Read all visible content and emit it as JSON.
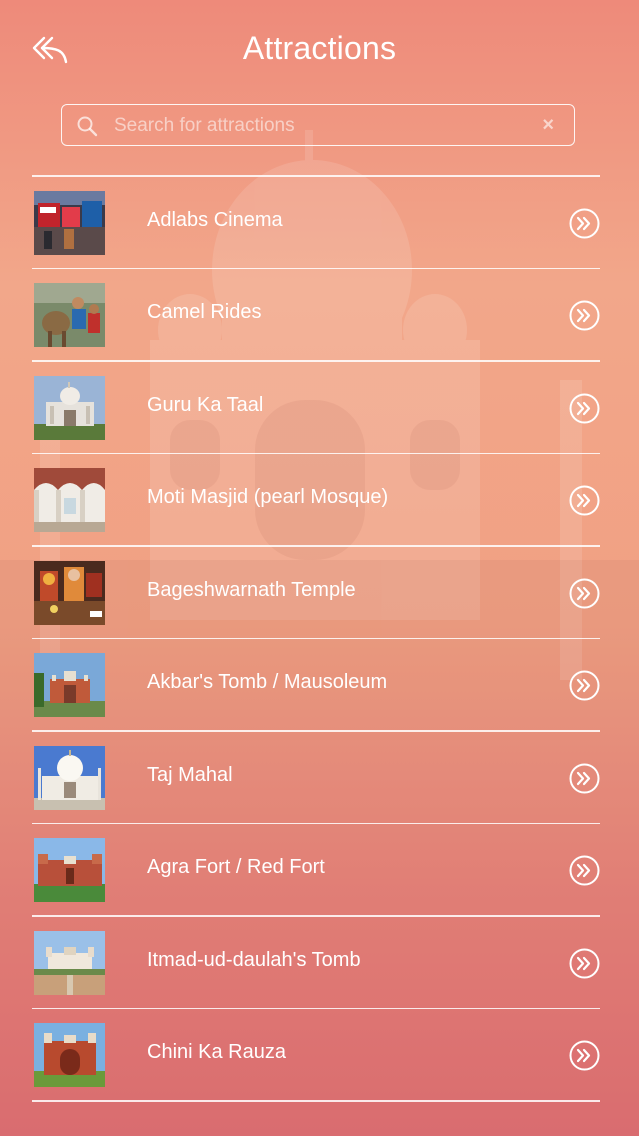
{
  "header": {
    "title": "Attractions",
    "back_icon": "back-arrow-icon"
  },
  "search": {
    "placeholder": "Search for attractions",
    "value": "",
    "search_icon": "search-icon",
    "clear_icon": "close-icon",
    "clear_label": "×"
  },
  "attractions": [
    {
      "label": "Adlabs Cinema",
      "thumb": "cinema"
    },
    {
      "label": "Camel Rides",
      "thumb": "camel"
    },
    {
      "label": "Guru Ka Taal",
      "thumb": "temple-white"
    },
    {
      "label": "Moti Masjid (pearl Mosque)",
      "thumb": "arches"
    },
    {
      "label": "Bageshwarnath Temple",
      "thumb": "shrine"
    },
    {
      "label": "Akbar's Tomb / Mausoleum",
      "thumb": "red-tomb"
    },
    {
      "label": "Taj Mahal",
      "thumb": "taj"
    },
    {
      "label": "Agra Fort / Red Fort",
      "thumb": "fort"
    },
    {
      "label": "Itmad-ud-daulah's Tomb",
      "thumb": "white-tomb"
    },
    {
      "label": "Chini Ka Rauza",
      "thumb": "gate"
    }
  ],
  "row_action_icon": "chevron-double-right-icon",
  "colors": {
    "bg_top": "#ee8a7a",
    "bg_mid": "#f2a78a",
    "bg_bottom": "#e06e73",
    "text": "#ffffff"
  }
}
